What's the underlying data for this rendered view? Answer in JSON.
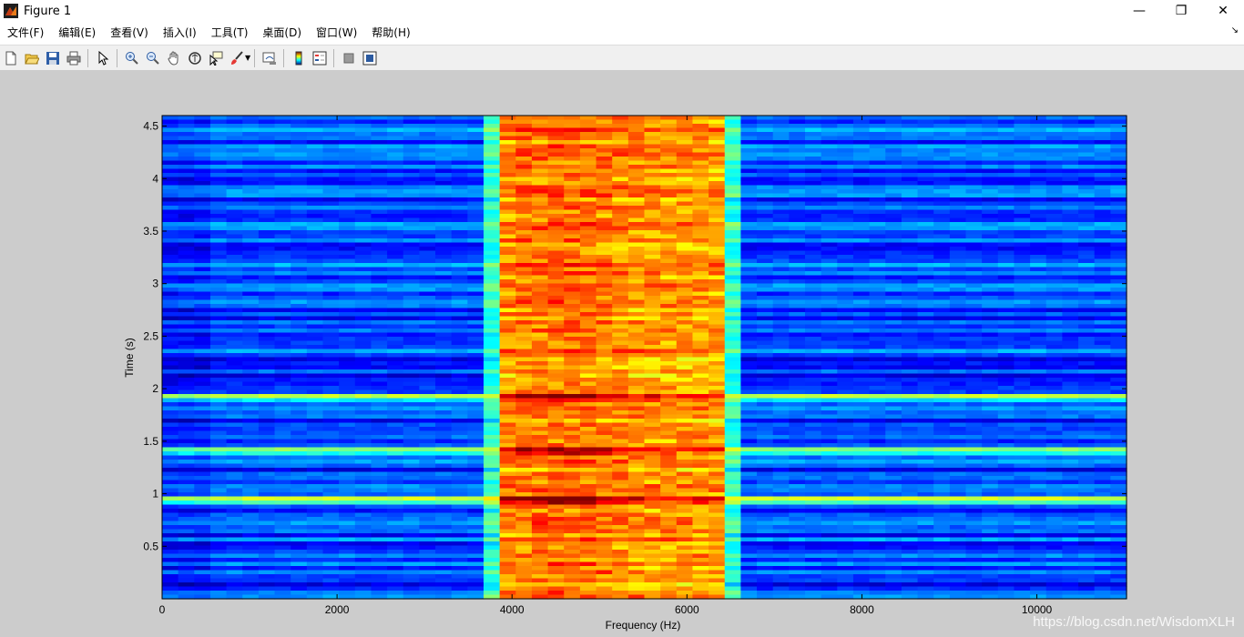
{
  "window": {
    "title": "Figure 1",
    "controls": {
      "minimize": "—",
      "restore": "❐",
      "close": "✕"
    }
  },
  "menu": {
    "items": [
      "文件(F)",
      "编辑(E)",
      "查看(V)",
      "插入(I)",
      "工具(T)",
      "桌面(D)",
      "窗口(W)",
      "帮助(H)"
    ],
    "overflow": "↘"
  },
  "toolbar": {
    "buttons": [
      "new-figure-icon",
      "open-file-icon",
      "save-icon",
      "print-icon",
      "edit-plot-arrow-icon",
      "zoom-in-icon",
      "zoom-out-icon",
      "pan-hand-icon",
      "rotate-3d-icon",
      "data-cursor-icon",
      "brush-icon",
      "link-plot-icon",
      "insert-colorbar-icon",
      "insert-legend-icon",
      "hide-plot-tools-icon",
      "show-plot-tools-icon"
    ]
  },
  "chart_data": {
    "type": "heatmap",
    "colormap": "jet",
    "xlabel": "Frequency (Hz)",
    "ylabel": "Time (s)",
    "xlim": [
      0,
      11025
    ],
    "ylim": [
      0,
      4.6
    ],
    "xticks": [
      0,
      2000,
      4000,
      6000,
      8000,
      10000
    ],
    "yticks": [
      0.5,
      1,
      1.5,
      2,
      2.5,
      3,
      3.5,
      4,
      4.5
    ],
    "ytick_labels": [
      "0.5",
      "1",
      "1.5",
      "2",
      "2.5",
      "3",
      "3.5",
      "4",
      "4.5"
    ],
    "xtick_labels": [
      "0",
      "2000",
      "4000",
      "6000",
      "8000",
      "10000"
    ],
    "high_energy_band_hz": [
      3800,
      6400
    ],
    "transition_band_hz": [
      3600,
      6600
    ],
    "peak_frequency_hz": 4600,
    "bursts_time_s": [
      0.95,
      1.4,
      1.92
    ],
    "levels": {
      "background": 0.2,
      "transition": 0.42,
      "band": 0.72,
      "peak": 0.97
    }
  },
  "watermark": "https://blog.csdn.net/WisdomXLH"
}
